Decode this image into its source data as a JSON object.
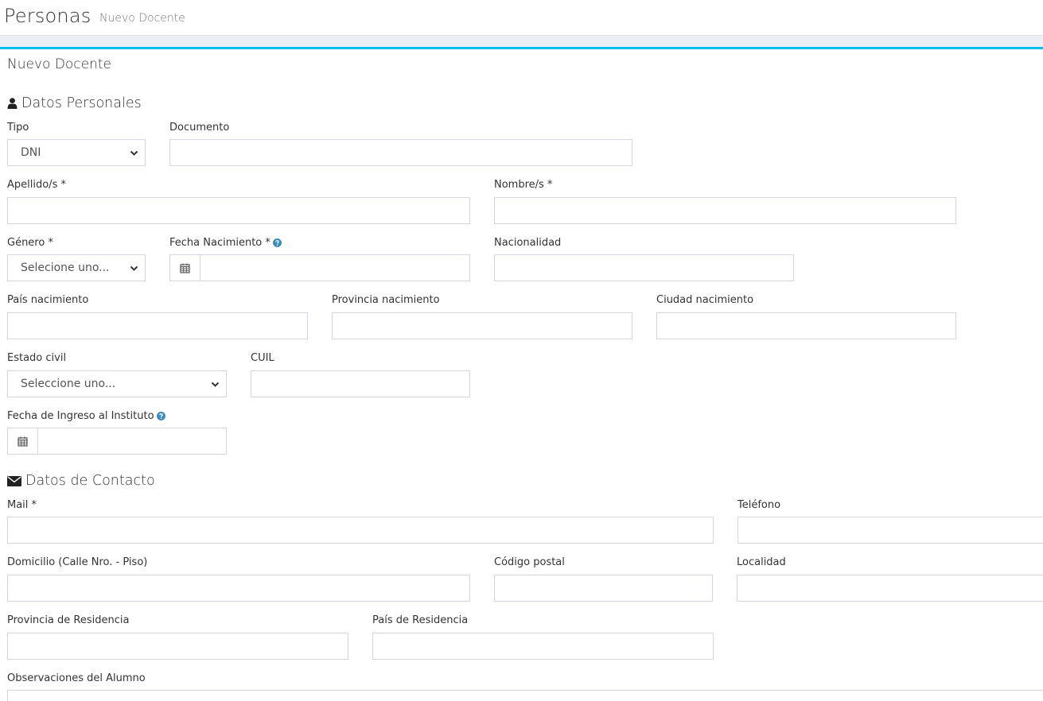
{
  "header": {
    "title": "Personas",
    "subtitle": "Nuevo Docente"
  },
  "box": {
    "title": "Nuevo Docente"
  },
  "sections": {
    "personal": {
      "title": "Datos Personales",
      "icon": "user-icon"
    },
    "contact": {
      "title": "Datos de Contacto",
      "icon": "envelope-icon"
    }
  },
  "fields": {
    "tipo": {
      "label": "Tipo",
      "value": "DNI"
    },
    "documento": {
      "label": "Documento",
      "value": ""
    },
    "apellido": {
      "label": "Apellido/s *",
      "value": ""
    },
    "nombre": {
      "label": "Nombre/s *",
      "value": ""
    },
    "genero": {
      "label": "Género *",
      "value": "Selecione uno..."
    },
    "fecha_nacimiento": {
      "label": "Fecha Nacimiento *",
      "value": ""
    },
    "nacionalidad": {
      "label": "Nacionalidad",
      "value": ""
    },
    "pais_nacimiento": {
      "label": "País nacimiento",
      "value": ""
    },
    "provincia_nacimiento": {
      "label": "Provincia nacimiento",
      "value": ""
    },
    "ciudad_nacimiento": {
      "label": "Ciudad nacimiento",
      "value": ""
    },
    "estado_civil": {
      "label": "Estado civil",
      "value": "Seleccione uno..."
    },
    "cuil": {
      "label": "CUIL",
      "value": ""
    },
    "fecha_ingreso": {
      "label": "Fecha de Ingreso al Instituto",
      "value": ""
    },
    "mail": {
      "label": "Mail *",
      "value": ""
    },
    "telefono": {
      "label": "Teléfono",
      "value": ""
    },
    "domicilio": {
      "label": "Domicilio (Calle Nro. - Piso)",
      "value": ""
    },
    "codigo_postal": {
      "label": "Código postal",
      "value": ""
    },
    "localidad": {
      "label": "Localidad",
      "value": ""
    },
    "provincia_residencia": {
      "label": "Provincia de Residencia",
      "value": ""
    },
    "pais_residencia": {
      "label": "País de Residencia",
      "value": ""
    },
    "observaciones": {
      "label": "Observaciones del Alumno",
      "value": ""
    }
  },
  "colors": {
    "accent": "#00c0ef",
    "help_icon": "#3c8dbc",
    "border": "#d2d6de",
    "band": "#ecf0f5"
  }
}
